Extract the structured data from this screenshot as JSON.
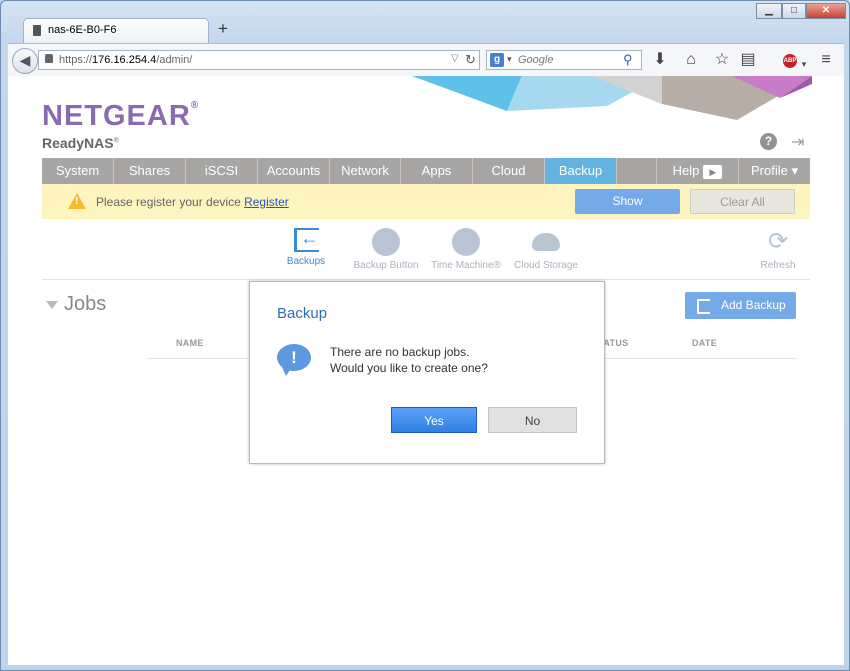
{
  "browser": {
    "tab_title": "nas-6E-B0-F6",
    "new_tab": "+",
    "url_scheme": "https://",
    "url_host": "176.16.254.4",
    "url_path": "/admin/",
    "search_placeholder": "Google",
    "search_engine_icon": "google-g-icon",
    "window_controls": {
      "minimize": "▁",
      "maximize": "□",
      "close": "✕"
    }
  },
  "header": {
    "logo": "NETGEAR",
    "logo_mark": "®",
    "product": "ReadyNAS",
    "product_mark": "®",
    "help_glyph": "?"
  },
  "menu": {
    "items": [
      "System",
      "Shares",
      "iSCSI",
      "Accounts",
      "Network",
      "Apps",
      "Cloud",
      "Backup",
      "",
      "Help",
      "Profile ▾"
    ],
    "active": "Backup"
  },
  "notice": {
    "text": "Please register your device ",
    "link": "Register",
    "show_button": "Show",
    "clear_button": "Clear All"
  },
  "subtabs": {
    "items": [
      "Backups",
      "Backup Button",
      "Time Machine®",
      "Cloud Storage"
    ],
    "refresh": "Refresh",
    "active": "Backups"
  },
  "jobs": {
    "title": "Jobs",
    "add_button": "Add Backup",
    "columns": [
      "NAME",
      "STATUS",
      "DATE"
    ]
  },
  "dialog": {
    "title": "Backup",
    "message_line1": "There are no backup jobs.",
    "message_line2": "Would you like to create one?",
    "yes": "Yes",
    "no": "No"
  },
  "colors": {
    "brand_purple": "#8a6bb0",
    "accent_blue": "#62b3df",
    "button_blue": "#75aae8",
    "notice_yellow": "#fdf4bf"
  }
}
